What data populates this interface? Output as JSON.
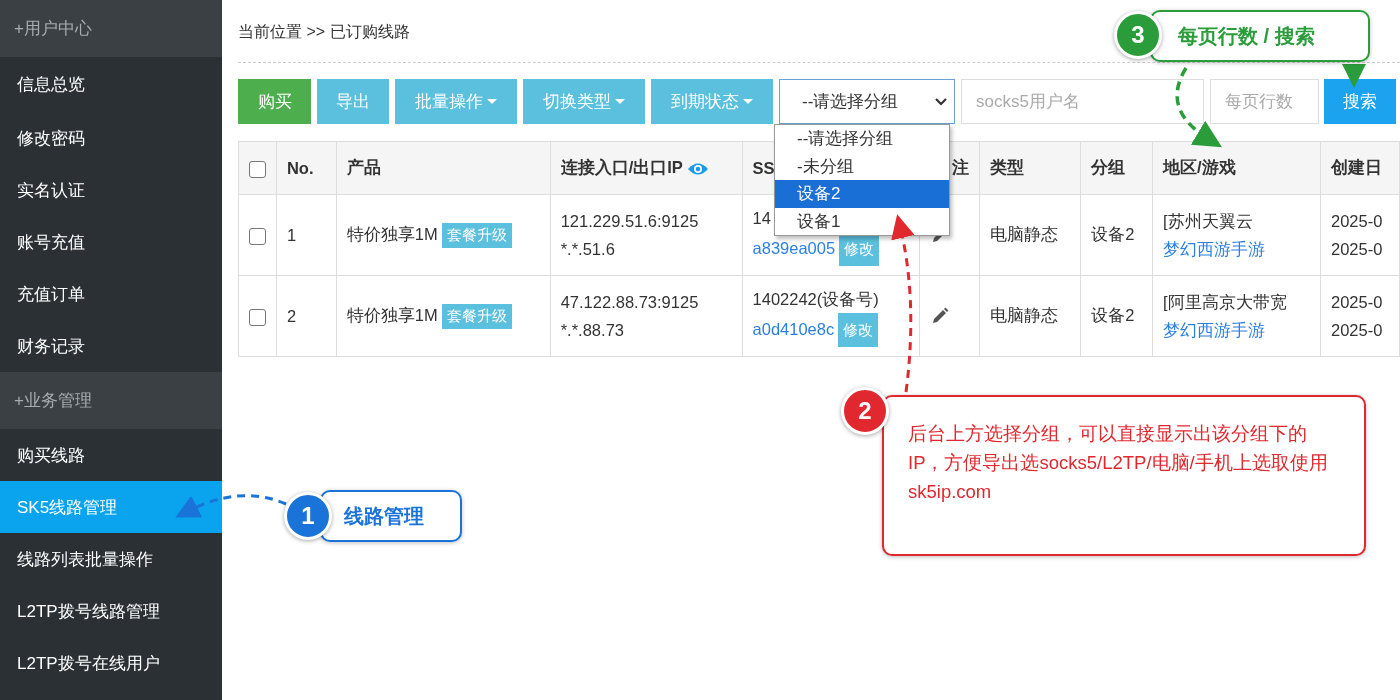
{
  "sidebar": {
    "sections": [
      {
        "title": "+用户中心",
        "items": [
          {
            "label": "信息总览",
            "selected": false
          },
          {
            "label": "修改密码",
            "selected": false
          },
          {
            "label": "实名认证",
            "selected": false
          },
          {
            "label": "账号充值",
            "selected": false
          },
          {
            "label": "充值订单",
            "selected": false
          },
          {
            "label": "财务记录",
            "selected": false
          }
        ]
      },
      {
        "title": "+业务管理",
        "items": [
          {
            "label": "购买线路",
            "selected": false
          },
          {
            "label": "SK5线路管理",
            "selected": true
          },
          {
            "label": "线路列表批量操作",
            "selected": false
          },
          {
            "label": "L2TP拨号线路管理",
            "selected": false
          },
          {
            "label": "L2TP拨号在线用户",
            "selected": false
          }
        ]
      }
    ]
  },
  "breadcrumb": "当前位置 >> 已订购线路",
  "toolbar": {
    "buttons": [
      {
        "label": "购买",
        "kind": "success"
      },
      {
        "label": "导出",
        "kind": "info"
      },
      {
        "label": "批量操作",
        "kind": "dropdown"
      },
      {
        "label": "切换类型",
        "kind": "dropdown"
      },
      {
        "label": "到期状态",
        "kind": "dropdown"
      }
    ],
    "group_select": {
      "value": "--请选择分组",
      "expanded": true,
      "options": [
        {
          "label": "--请选择分组",
          "highlighted": false
        },
        {
          "label": "-未分组",
          "highlighted": false
        },
        {
          "label": "设备2",
          "highlighted": true
        },
        {
          "label": "设备1",
          "highlighted": false
        }
      ]
    },
    "username_field": {
      "placeholder": "socks5用户名"
    },
    "rows_field": {
      "placeholder": "每页行数"
    },
    "search_button": "搜索"
  },
  "table": {
    "header_checked": false,
    "columns": [
      {
        "label": "No.",
        "kind": "text"
      },
      {
        "label": "产品",
        "kind": "text"
      },
      {
        "label": "连接入口/出口IP",
        "kind": "eye"
      },
      {
        "label": "SS",
        "kind": "text"
      },
      {
        "label": "注",
        "kind": "right"
      },
      {
        "label": "类型",
        "kind": "text"
      },
      {
        "label": "分组",
        "kind": "text"
      },
      {
        "label": "地区/游戏",
        "kind": "text"
      },
      {
        "label": "创建日",
        "kind": "text"
      }
    ],
    "rows": [
      {
        "checked": false,
        "no": "1",
        "product": "特价独享1M",
        "upgrade": "套餐升级",
        "entry_ip": "121.229.51.6:9125",
        "exit_ip": "*.*.51.6",
        "device": "14",
        "code": "a839ea005",
        "edit": "修改",
        "type": "电脑静态",
        "group": "设备2",
        "region": "[苏州天翼云",
        "game": "梦幻西游手游",
        "created": "2025-0",
        "expires": "2025-0"
      },
      {
        "checked": false,
        "no": "2",
        "product": "特价独享1M",
        "upgrade": "套餐升级",
        "entry_ip": "47.122.88.73:9125",
        "exit_ip": "*.*.88.73",
        "device": "1402242(设备号)",
        "code": "a0d410e8c",
        "edit": "修改",
        "type": "电脑静态",
        "group": "设备2",
        "region": "[阿里高京大带宽",
        "game": "梦幻西游手游",
        "created": "2025-0",
        "expires": "2025-0"
      }
    ]
  },
  "callouts": [
    {
      "number": "3",
      "kind": "pill",
      "text": "每页行数 / 搜索",
      "color": "#2a9d3a"
    },
    {
      "number": "2",
      "kind": "box",
      "text": "后台上方选择分组，可以直接显示出该分组下的IP，方便导出选socks5/L2TP/电脑/手机上选取使用",
      "link": "sk5ip.com",
      "color": "#e0282e"
    },
    {
      "number": "1",
      "kind": "pill",
      "text": "线路管理",
      "color": "#1a73d9"
    }
  ]
}
